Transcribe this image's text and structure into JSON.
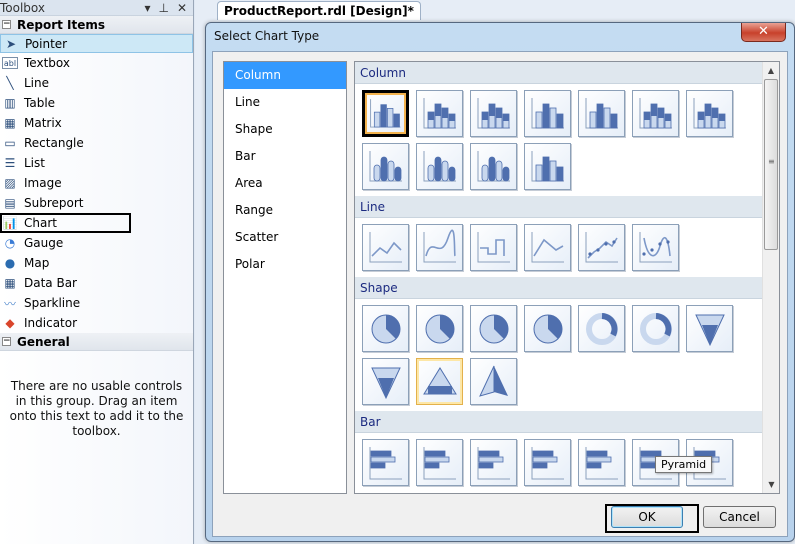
{
  "toolbox": {
    "title": "Toolbox",
    "controls": {
      "dropdown": "▾",
      "pin": "⊥",
      "close": "✕"
    },
    "groups": [
      {
        "name": "Report Items",
        "expander": "−"
      },
      {
        "name": "General",
        "expander": "−"
      }
    ],
    "items": [
      {
        "label": "Pointer",
        "icon": "pointer-icon",
        "glyph": "➤"
      },
      {
        "label": "Textbox",
        "icon": "textbox-icon",
        "glyph": "abl"
      },
      {
        "label": "Line",
        "icon": "line-icon",
        "glyph": "╲"
      },
      {
        "label": "Table",
        "icon": "table-icon",
        "glyph": "▥"
      },
      {
        "label": "Matrix",
        "icon": "matrix-icon",
        "glyph": "▦"
      },
      {
        "label": "Rectangle",
        "icon": "rectangle-icon",
        "glyph": "▭"
      },
      {
        "label": "List",
        "icon": "list-icon",
        "glyph": "☰"
      },
      {
        "label": "Image",
        "icon": "image-icon",
        "glyph": "▨"
      },
      {
        "label": "Subreport",
        "icon": "subreport-icon",
        "glyph": "▤"
      },
      {
        "label": "Chart",
        "icon": "chart-icon",
        "glyph": "📊"
      },
      {
        "label": "Gauge",
        "icon": "gauge-icon",
        "glyph": "◔"
      },
      {
        "label": "Map",
        "icon": "map-icon",
        "glyph": "●"
      },
      {
        "label": "Data Bar",
        "icon": "data-bar-icon",
        "glyph": "▦"
      },
      {
        "label": "Sparkline",
        "icon": "sparkline-icon",
        "glyph": "〰"
      },
      {
        "label": "Indicator",
        "icon": "indicator-icon",
        "glyph": "◆"
      }
    ],
    "general_message": "There are no usable controls in this group. Drag an item onto this text to add it to the toolbox."
  },
  "document_tab": {
    "label": "ProductReport.rdl [Design]*"
  },
  "dialog": {
    "title": "Select Chart Type",
    "close_glyph": "✕",
    "chart_types": [
      "Column",
      "Line",
      "Shape",
      "Bar",
      "Area",
      "Range",
      "Scatter",
      "Polar"
    ],
    "selected_type": "Column",
    "sections": [
      {
        "name": "Column",
        "icons": [
          "column",
          "stacked-column",
          "100-stacked-column",
          "3d-clustered-column",
          "3d-column",
          "3d-stacked-column",
          "3d-100-stacked-column",
          "3d-cylinder",
          "3d-stacked-cylinder",
          "3d-100-stacked-cylinder",
          "3d-column-alt"
        ]
      },
      {
        "name": "Line",
        "icons": [
          "line",
          "smooth-line",
          "stepped-line",
          "3d-line",
          "line-with-markers",
          "smooth-line-with-markers"
        ]
      },
      {
        "name": "Shape",
        "icons": [
          "pie",
          "exploded-pie",
          "3d-pie",
          "3d-exploded-pie",
          "doughnut",
          "exploded-doughnut",
          "funnel",
          "3d-funnel",
          "pyramid",
          "3d-pyramid"
        ]
      },
      {
        "name": "Bar",
        "icons": [
          "bar",
          "stacked-bar",
          "100-stacked-bar",
          "3d-clustered-bar",
          "3d-stacked-bar",
          "3d-100-stacked-bar",
          "3d-cylinder-bar"
        ]
      }
    ],
    "tooltip": "Pyramid",
    "ok_label": "OK",
    "cancel_label": "Cancel"
  }
}
